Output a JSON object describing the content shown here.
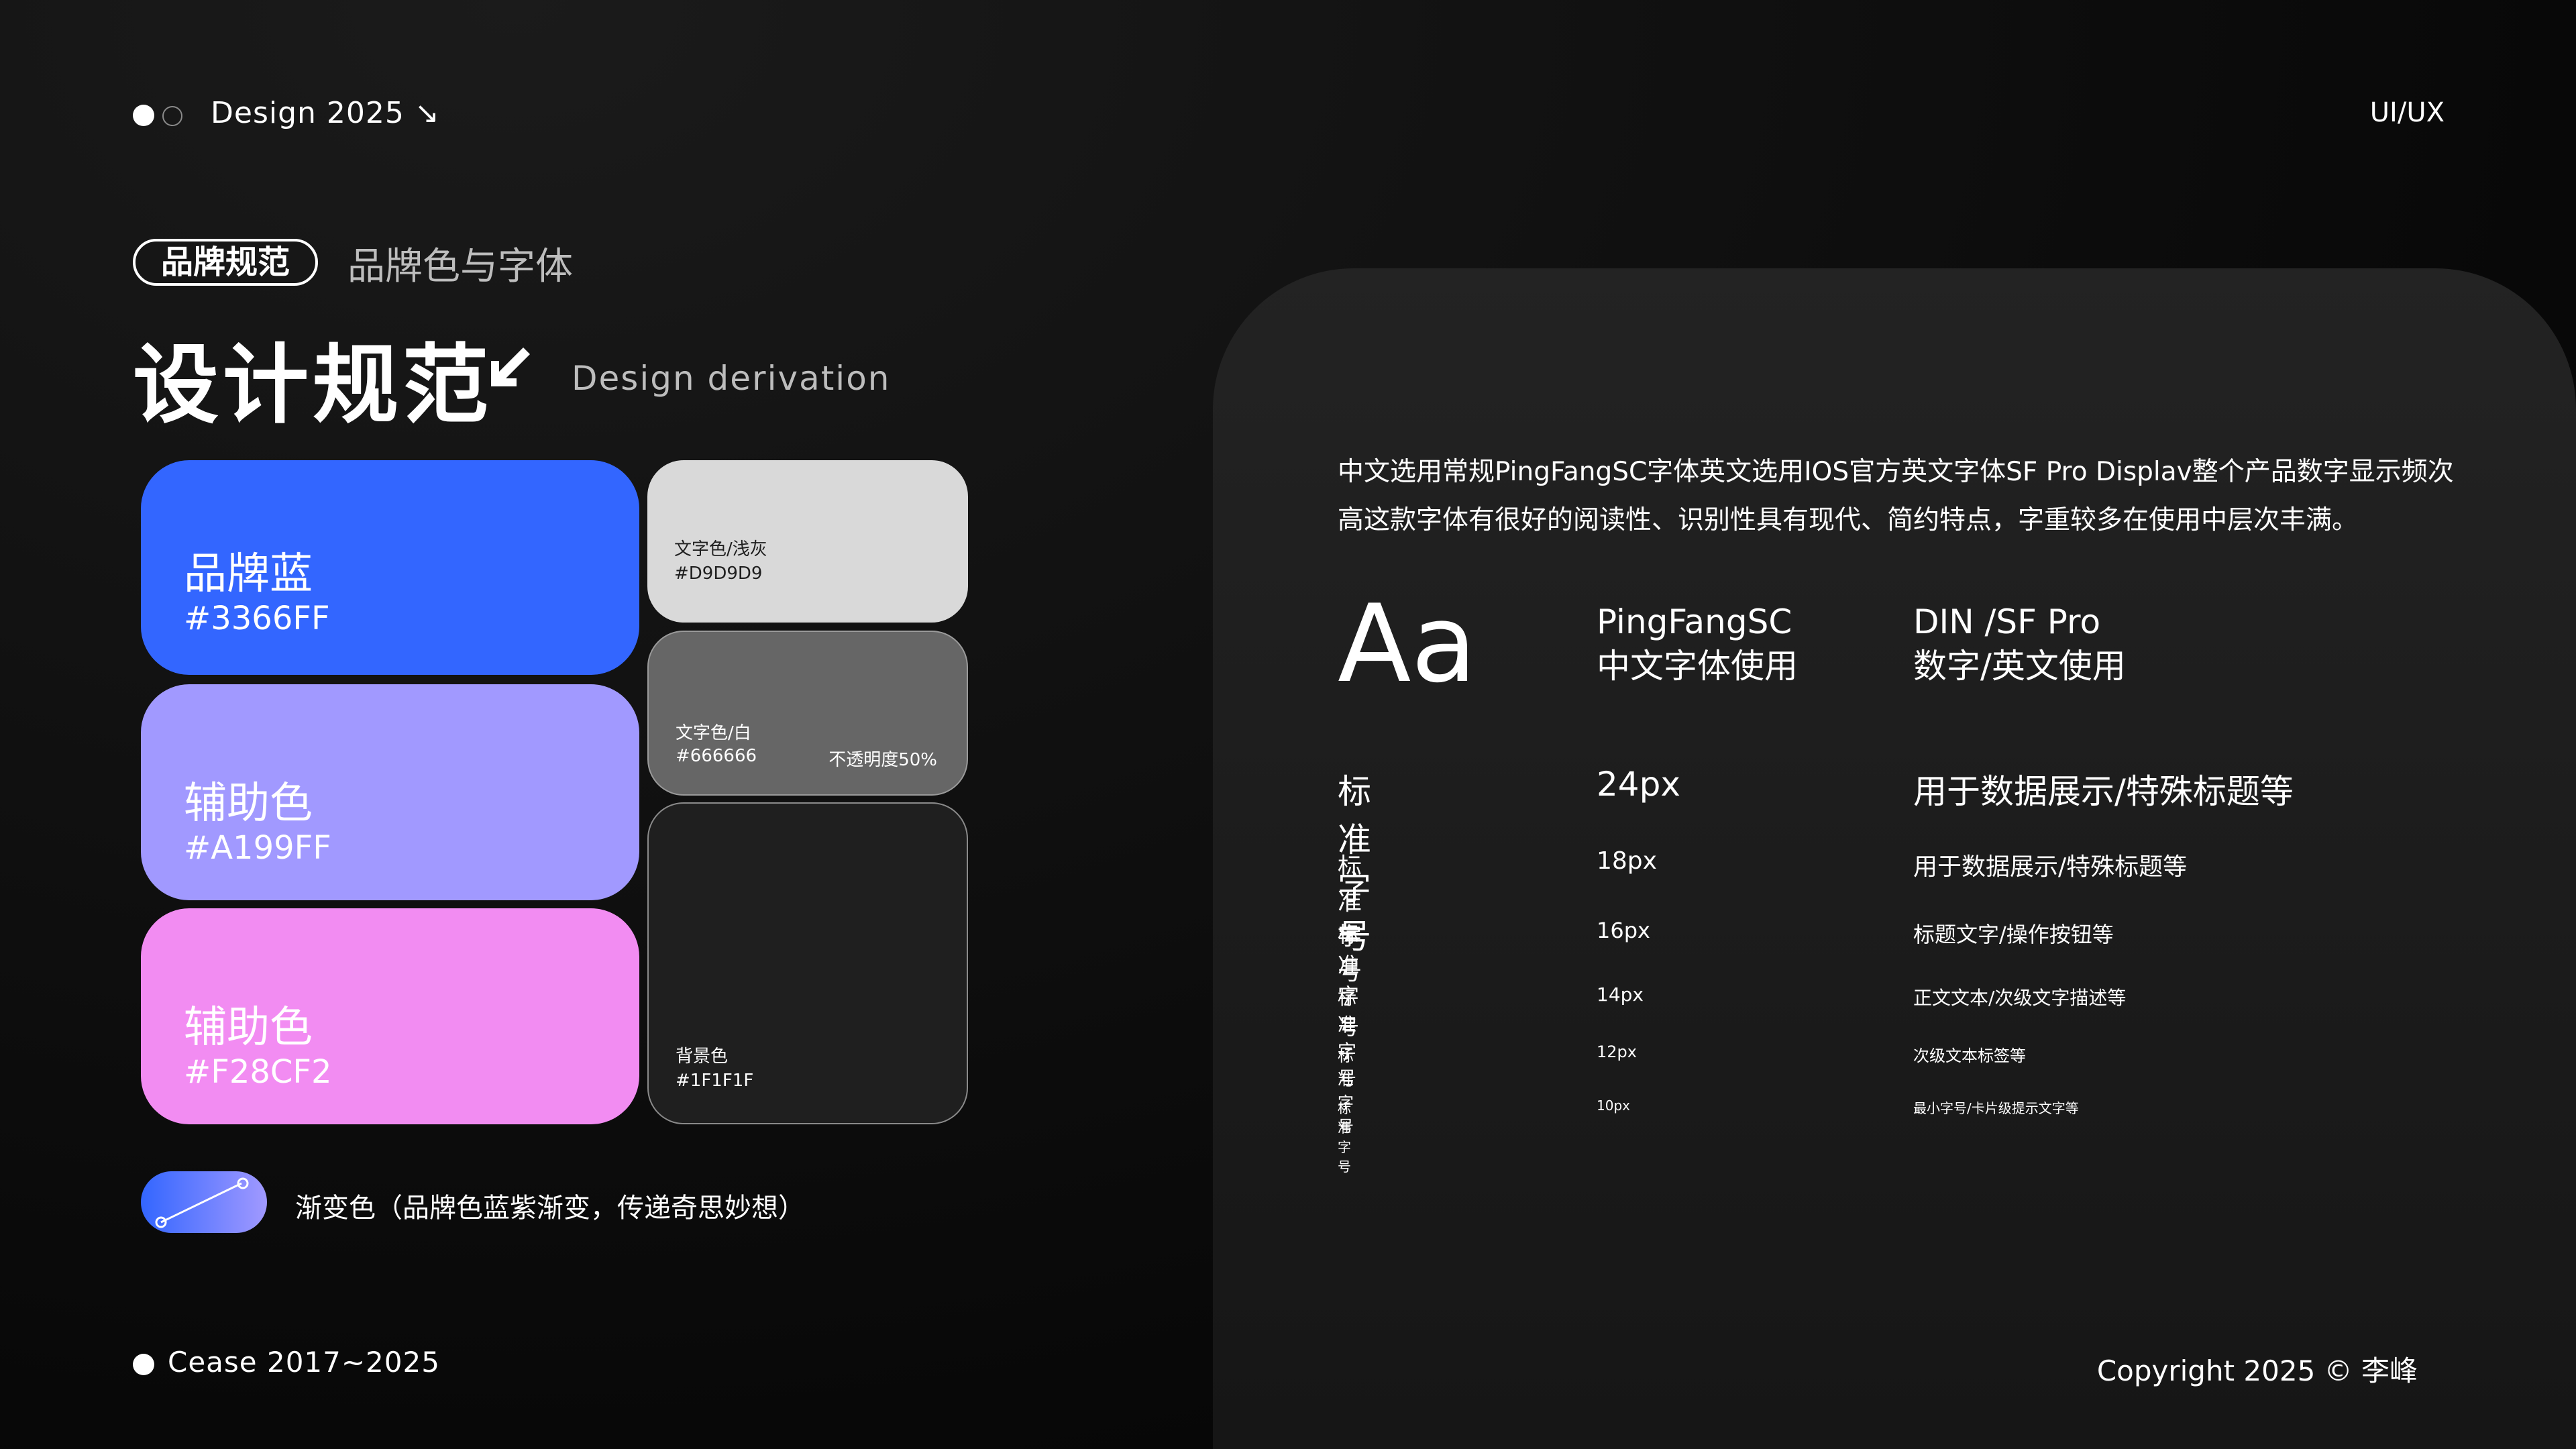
{
  "header": {
    "title": "Design 2025 ↘",
    "right": "UI/UX"
  },
  "section": {
    "tag": "品牌规范",
    "tag_sub": "品牌色与字体",
    "title": "设计规范",
    "title_sub": "Design derivation"
  },
  "colors": {
    "brand_blue": {
      "label": "品牌蓝",
      "hex": "#3366FF"
    },
    "aux_purple": {
      "label": "辅助色",
      "hex": "#A199FF"
    },
    "aux_pink": {
      "label": "辅助色",
      "hex": "#F28CF2"
    },
    "text_gray": {
      "label": "文字色/浅灰",
      "hex": "#D9D9D9"
    },
    "text_white": {
      "label": "文字色/白",
      "hex": "#666666",
      "note": "不透明度50%"
    },
    "background": {
      "label": "背景色",
      "hex": "#1F1F1F"
    },
    "gradient_text": "渐变色（品牌色蓝紫渐变，传递奇思妙想）"
  },
  "typography": {
    "description": "中文选用常规PingFangSC字体英文选用IOS官方英文字体SF Pro Displav整个产品数字显示频次高这款字体有很好的阅读性、识别性具有现代、简约特点，字重较多在使用中层次丰满。",
    "sample": "Aa",
    "font_cn": {
      "name": "PingFangSC",
      "usage": "中文字体使用"
    },
    "font_en": {
      "name": "DIN /SF Pro",
      "usage": "数字/英文使用"
    },
    "sizes": [
      {
        "name": "标准字号",
        "size": "24px",
        "usage": "用于数据展示/特殊标题等"
      },
      {
        "name": "标准字号",
        "size": "18px",
        "usage": "用于数据展示/特殊标题等"
      },
      {
        "name": "标准字号",
        "size": "16px",
        "usage": "标题文字/操作按钮等"
      },
      {
        "name": "标准字号",
        "size": "14px",
        "usage": "正文文本/次级文字描述等"
      },
      {
        "name": "标准字号",
        "size": "12px",
        "usage": "次级文本标签等"
      },
      {
        "name": "标准字号",
        "size": "10px",
        "usage": "最小字号/卡片级提示文字等"
      }
    ]
  },
  "footer": {
    "left": "Cease 2017~2025",
    "right": "Copyright 2025 © 李峰"
  }
}
